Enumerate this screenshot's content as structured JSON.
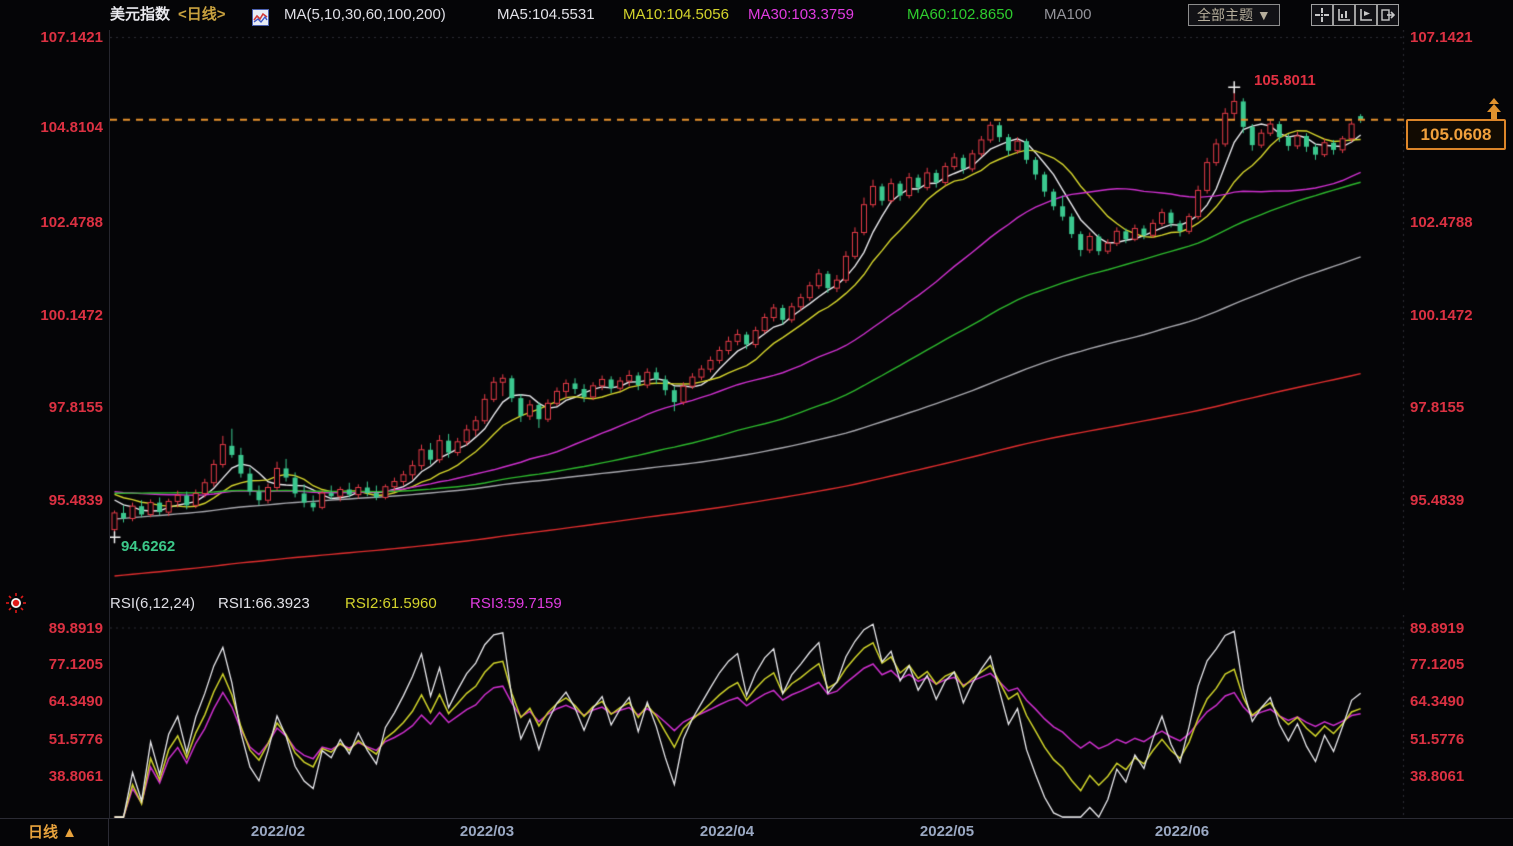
{
  "header": {
    "title": "美元指数",
    "period_tag": "<日线>",
    "ma_params": "MA(5,10,30,60,100,200)",
    "ma_labels": [
      {
        "text": "MA5:104.5531",
        "color": "#e2e2e8"
      },
      {
        "text": "MA10:104.5056",
        "color": "#d4d42c"
      },
      {
        "text": "MA30:103.3759",
        "color": "#e13ce1"
      },
      {
        "text": "MA60:102.8650",
        "color": "#2ecc2e"
      },
      {
        "text": "MA100",
        "color": "#94949b"
      }
    ],
    "theme_dropdown": "全部主题 ▼"
  },
  "axes": {
    "main_left": [
      "107.1421",
      "104.8104",
      "102.4788",
      "100.1472",
      "97.8155",
      "95.4839"
    ],
    "main_right": [
      "107.1421",
      "102.4788",
      "100.1472",
      "97.8155",
      "95.4839"
    ],
    "rsi_left": [
      "89.8919",
      "77.1205",
      "64.3490",
      "51.5776",
      "38.8061"
    ],
    "rsi_right": [
      "89.8919",
      "77.1205",
      "64.3490",
      "51.5776",
      "38.8061"
    ]
  },
  "annotations": {
    "high_label": "105.8011",
    "low_label": "94.6262"
  },
  "price_tag": {
    "value": "105.0608"
  },
  "rsi_header": {
    "params": "RSI(6,12,24)",
    "labels": [
      {
        "text": "RSI1:66.3923",
        "color": "#dcdce8"
      },
      {
        "text": "RSI2:61.5960",
        "color": "#cfd32a"
      },
      {
        "text": "RSI3:59.7159",
        "color": "#e13ce1"
      }
    ]
  },
  "bottom": {
    "tab_label": "日线 ▲",
    "months": [
      "2022/02",
      "2022/03",
      "2022/04",
      "2022/05",
      "2022/06"
    ]
  },
  "chart_data": {
    "type": "candlestick",
    "title": "美元指数 日线 (US Dollar Index daily with MA overlays and RSI pane)",
    "y_axis_ticks": [
      107.1421,
      104.8104,
      102.4788,
      100.1472,
      97.8155,
      95.4839
    ],
    "rsi_axis_ticks": [
      89.8919,
      77.1205,
      64.349,
      51.5776,
      38.8061
    ],
    "x_labels": [
      "2022/02",
      "2022/03",
      "2022/04",
      "2022/05",
      "2022/06"
    ],
    "last_price": 105.0608,
    "high_annotation": {
      "index": 124,
      "value": 105.8011
    },
    "low_annotation": {
      "index": 0,
      "value": 94.6262
    },
    "up_color": "#e23b47",
    "down_color": "#3bc88f",
    "last_price_line_color": "#e8922e",
    "ma_series": [
      {
        "period": 5,
        "color": "#e8e8ec"
      },
      {
        "period": 10,
        "color": "#d4d42c"
      },
      {
        "period": 30,
        "color": "#cf30cf"
      },
      {
        "period": 60,
        "color": "#2db82d"
      },
      {
        "period": 100,
        "color": "#a8a8ae"
      },
      {
        "period": 200,
        "color": "#e02e2e"
      }
    ],
    "rsi_series": [
      {
        "period": 6,
        "color": "#eaeaee"
      },
      {
        "period": 12,
        "color": "#cfd32a"
      },
      {
        "period": 24,
        "color": "#cc2fcc"
      }
    ],
    "rsi_values_shown": [
      66.3923,
      61.596,
      59.7159
    ],
    "prehistory_anchors": [
      [
        260,
        88.5
      ],
      [
        210,
        90.5
      ],
      [
        160,
        92.0
      ],
      [
        110,
        93.0
      ],
      [
        70,
        94.3
      ],
      [
        45,
        95.9
      ],
      [
        25,
        95.6
      ],
      [
        10,
        95.9
      ],
      [
        1,
        95.5
      ]
    ],
    "candles": [
      [
        94.74,
        95.22,
        94.63,
        95.16
      ],
      [
        95.16,
        95.35,
        94.92,
        95.02
      ],
      [
        95.02,
        95.42,
        94.95,
        95.33
      ],
      [
        95.33,
        95.48,
        95.05,
        95.12
      ],
      [
        95.12,
        95.5,
        95.05,
        95.42
      ],
      [
        95.42,
        95.55,
        95.1,
        95.18
      ],
      [
        95.18,
        95.52,
        95.08,
        95.45
      ],
      [
        95.45,
        95.72,
        95.3,
        95.6
      ],
      [
        95.6,
        95.7,
        95.25,
        95.35
      ],
      [
        95.35,
        95.75,
        95.28,
        95.65
      ],
      [
        95.65,
        96.02,
        95.55,
        95.92
      ],
      [
        95.92,
        96.5,
        95.82,
        96.38
      ],
      [
        96.38,
        97.1,
        96.3,
        96.88
      ],
      [
        96.85,
        97.28,
        96.55,
        96.62
      ],
      [
        96.62,
        96.8,
        96.05,
        96.15
      ],
      [
        96.15,
        96.3,
        95.6,
        95.7
      ],
      [
        95.7,
        95.85,
        95.35,
        95.48
      ],
      [
        95.48,
        95.9,
        95.4,
        95.8
      ],
      [
        95.8,
        96.45,
        95.72,
        96.28
      ],
      [
        96.28,
        96.52,
        95.95,
        96.05
      ],
      [
        96.05,
        96.18,
        95.55,
        95.65
      ],
      [
        95.65,
        95.88,
        95.3,
        95.42
      ],
      [
        95.42,
        95.6,
        95.2,
        95.3
      ],
      [
        95.3,
        95.72,
        95.25,
        95.66
      ],
      [
        95.66,
        95.85,
        95.5,
        95.58
      ],
      [
        95.58,
        95.82,
        95.45,
        95.75
      ],
      [
        95.75,
        95.92,
        95.55,
        95.62
      ],
      [
        95.62,
        95.88,
        95.52,
        95.8
      ],
      [
        95.8,
        95.95,
        95.58,
        95.66
      ],
      [
        95.66,
        95.85,
        95.48,
        95.55
      ],
      [
        95.55,
        95.88,
        95.5,
        95.82
      ],
      [
        95.82,
        96.05,
        95.7,
        95.95
      ],
      [
        95.95,
        96.22,
        95.85,
        96.12
      ],
      [
        96.12,
        96.48,
        96.0,
        96.35
      ],
      [
        96.35,
        96.88,
        96.25,
        96.75
      ],
      [
        96.75,
        96.92,
        96.38,
        96.5
      ],
      [
        96.5,
        97.12,
        96.42,
        96.98
      ],
      [
        96.98,
        97.15,
        96.55,
        96.68
      ],
      [
        96.68,
        97.05,
        96.6,
        96.95
      ],
      [
        96.95,
        97.38,
        96.85,
        97.25
      ],
      [
        97.25,
        97.6,
        97.1,
        97.48
      ],
      [
        97.48,
        98.15,
        97.4,
        98.02
      ],
      [
        98.02,
        98.58,
        97.95,
        98.45
      ],
      [
        98.45,
        98.65,
        98.1,
        98.55
      ],
      [
        98.55,
        98.62,
        97.95,
        98.05
      ],
      [
        98.05,
        98.15,
        97.45,
        97.6
      ],
      [
        97.6,
        98.0,
        97.5,
        97.88
      ],
      [
        97.88,
        97.95,
        97.3,
        97.52
      ],
      [
        97.52,
        98.02,
        97.45,
        97.92
      ],
      [
        97.92,
        98.32,
        97.85,
        98.22
      ],
      [
        98.22,
        98.52,
        98.05,
        98.42
      ],
      [
        98.42,
        98.55,
        98.15,
        98.28
      ],
      [
        98.28,
        98.4,
        97.95,
        98.08
      ],
      [
        98.08,
        98.45,
        98.0,
        98.36
      ],
      [
        98.36,
        98.62,
        98.25,
        98.52
      ],
      [
        98.52,
        98.6,
        98.18,
        98.3
      ],
      [
        98.3,
        98.58,
        98.22,
        98.48
      ],
      [
        98.48,
        98.75,
        98.35,
        98.62
      ],
      [
        98.62,
        98.7,
        98.25,
        98.38
      ],
      [
        98.38,
        98.8,
        98.3,
        98.7
      ],
      [
        98.7,
        98.82,
        98.4,
        98.52
      ],
      [
        98.52,
        98.62,
        98.12,
        98.25
      ],
      [
        98.25,
        98.35,
        97.72,
        97.95
      ],
      [
        97.95,
        98.45,
        97.88,
        98.35
      ],
      [
        98.35,
        98.68,
        98.28,
        98.58
      ],
      [
        98.58,
        98.88,
        98.5,
        98.78
      ],
      [
        98.78,
        99.1,
        98.7,
        99.0
      ],
      [
        99.0,
        99.35,
        98.92,
        99.25
      ],
      [
        99.25,
        99.6,
        99.15,
        99.48
      ],
      [
        99.48,
        99.78,
        99.38,
        99.65
      ],
      [
        99.65,
        99.72,
        99.28,
        99.4
      ],
      [
        99.4,
        99.85,
        99.32,
        99.75
      ],
      [
        99.75,
        100.18,
        99.68,
        100.08
      ],
      [
        100.08,
        100.42,
        99.98,
        100.32
      ],
      [
        100.32,
        100.4,
        99.9,
        100.02
      ],
      [
        100.02,
        100.45,
        99.95,
        100.35
      ],
      [
        100.35,
        100.68,
        100.25,
        100.58
      ],
      [
        100.58,
        100.98,
        100.5,
        100.88
      ],
      [
        100.88,
        101.3,
        100.8,
        101.18
      ],
      [
        101.18,
        101.25,
        100.7,
        100.82
      ],
      [
        100.82,
        101.15,
        100.72,
        101.02
      ],
      [
        101.02,
        101.75,
        100.95,
        101.62
      ],
      [
        101.62,
        102.35,
        101.55,
        102.22
      ],
      [
        102.22,
        103.1,
        102.15,
        102.92
      ],
      [
        102.92,
        103.55,
        102.85,
        103.38
      ],
      [
        103.38,
        103.45,
        102.9,
        103.02
      ],
      [
        103.02,
        103.58,
        102.95,
        103.45
      ],
      [
        103.45,
        103.52,
        103.02,
        103.15
      ],
      [
        103.15,
        103.72,
        103.08,
        103.6
      ],
      [
        103.6,
        103.68,
        103.22,
        103.35
      ],
      [
        103.35,
        103.85,
        103.28,
        103.72
      ],
      [
        103.72,
        103.8,
        103.35,
        103.48
      ],
      [
        103.48,
        103.98,
        103.4,
        103.88
      ],
      [
        103.88,
        104.22,
        103.8,
        104.1
      ],
      [
        104.1,
        104.18,
        103.7,
        103.82
      ],
      [
        103.82,
        104.3,
        103.75,
        104.2
      ],
      [
        104.2,
        104.65,
        104.12,
        104.55
      ],
      [
        104.55,
        105.01,
        104.48,
        104.92
      ],
      [
        104.92,
        105.0,
        104.5,
        104.62
      ],
      [
        104.62,
        104.7,
        104.15,
        104.28
      ],
      [
        104.28,
        104.62,
        104.2,
        104.52
      ],
      [
        104.52,
        104.58,
        103.95,
        104.05
      ],
      [
        104.05,
        104.12,
        103.55,
        103.68
      ],
      [
        103.68,
        103.75,
        103.12,
        103.25
      ],
      [
        103.25,
        103.32,
        102.78,
        102.88
      ],
      [
        102.88,
        103.15,
        102.52,
        102.62
      ],
      [
        102.62,
        102.7,
        102.08,
        102.18
      ],
      [
        102.18,
        102.25,
        101.62,
        101.78
      ],
      [
        101.78,
        102.22,
        101.7,
        102.12
      ],
      [
        102.12,
        102.18,
        101.65,
        101.75
      ],
      [
        101.75,
        102.05,
        101.68,
        101.95
      ],
      [
        101.95,
        102.35,
        101.88,
        102.25
      ],
      [
        102.25,
        102.32,
        101.95,
        102.05
      ],
      [
        102.05,
        102.42,
        102.0,
        102.32
      ],
      [
        102.32,
        102.4,
        102.05,
        102.15
      ],
      [
        102.15,
        102.55,
        102.08,
        102.45
      ],
      [
        102.45,
        102.82,
        102.38,
        102.72
      ],
      [
        102.72,
        102.8,
        102.35,
        102.45
      ],
      [
        102.45,
        102.52,
        102.12,
        102.25
      ],
      [
        102.25,
        102.7,
        102.18,
        102.62
      ],
      [
        102.62,
        103.4,
        102.55,
        103.28
      ],
      [
        103.28,
        104.1,
        103.2,
        103.98
      ],
      [
        103.98,
        104.58,
        103.9,
        104.45
      ],
      [
        104.45,
        105.35,
        104.38,
        105.22
      ],
      [
        105.22,
        105.8,
        105.05,
        105.52
      ],
      [
        105.52,
        105.6,
        104.72,
        104.88
      ],
      [
        104.88,
        104.95,
        104.28,
        104.42
      ],
      [
        104.42,
        104.82,
        104.35,
        104.72
      ],
      [
        104.72,
        105.05,
        104.65,
        104.95
      ],
      [
        104.95,
        105.02,
        104.5,
        104.62
      ],
      [
        104.62,
        104.7,
        104.28,
        104.4
      ],
      [
        104.4,
        104.75,
        104.32,
        104.65
      ],
      [
        104.65,
        104.72,
        104.25,
        104.38
      ],
      [
        104.38,
        104.45,
        104.05,
        104.18
      ],
      [
        104.18,
        104.58,
        104.12,
        104.48
      ],
      [
        104.48,
        104.55,
        104.18,
        104.3
      ],
      [
        104.3,
        104.65,
        104.22,
        104.58
      ],
      [
        104.58,
        105.02,
        104.5,
        104.95
      ],
      [
        105.15,
        105.2,
        104.98,
        105.06
      ]
    ]
  }
}
